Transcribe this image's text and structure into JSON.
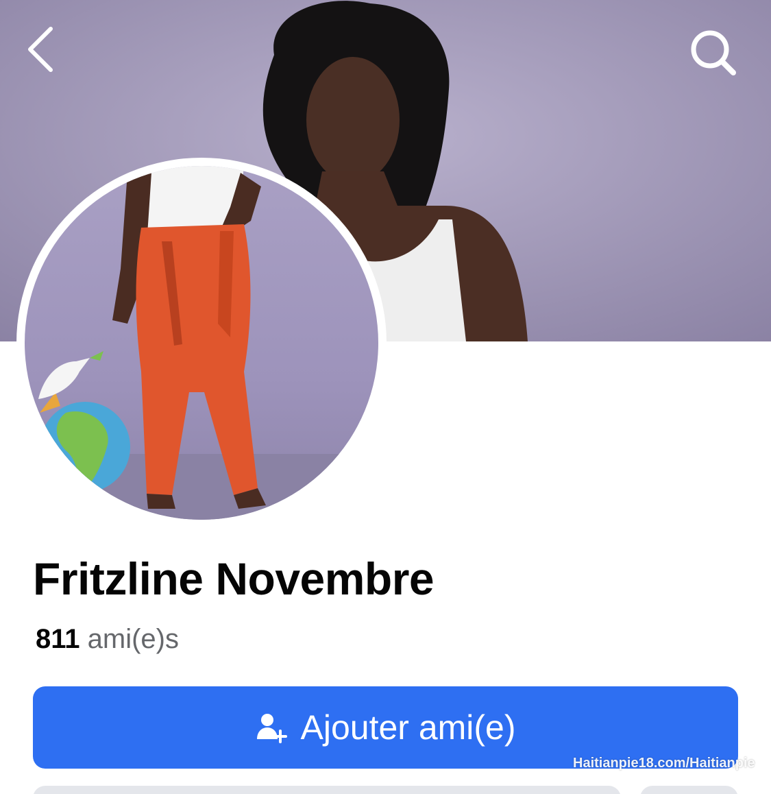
{
  "header": {
    "back_icon": "chevron-left-icon",
    "search_icon": "search-icon"
  },
  "profile": {
    "name": "Fritzline Novembre",
    "friends_count": "811",
    "friends_label": "ami(e)s"
  },
  "actions": {
    "add_friend_icon": "add-person-icon",
    "add_friend_label": "Ajouter ami(e)"
  },
  "watermark": "Haitianpie18.com/Haitianpie",
  "colors": {
    "primary_button": "#2e6ff2",
    "secondary_button": "#e4e6eb",
    "name_text": "#050505",
    "muted_text": "#65676b"
  }
}
